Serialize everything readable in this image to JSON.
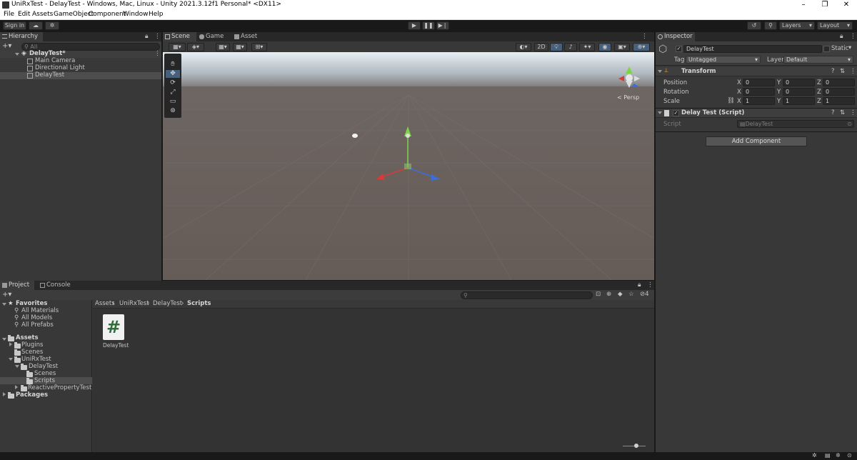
{
  "window": {
    "title": "UniRxTest - DelayTest - Windows, Mac, Linux - Unity 2021.3.12f1 Personal* <DX11>",
    "minimize": "–",
    "maximize": "❐",
    "close": "✕"
  },
  "menu": [
    "File",
    "Edit",
    "Assets",
    "GameObject",
    "Component",
    "Window",
    "Help"
  ],
  "toolbar": {
    "sign_in": "Sign in",
    "layers": "Layers",
    "layout": "Layout"
  },
  "hierarchy": {
    "tab": "Hierarchy",
    "search_placeholder": "All",
    "scene": "DelayTest*",
    "items": [
      "Main Camera",
      "Directional Light",
      "DelayTest"
    ]
  },
  "scene_view": {
    "tabs": [
      "Scene",
      "Game",
      "Asset Store"
    ],
    "mode_2d": "2D",
    "persp": "< Persp"
  },
  "inspector": {
    "tab": "Inspector",
    "object_name": "DelayTest",
    "static_label": "Static",
    "tag_label": "Tag",
    "tag_value": "Untagged",
    "layer_label": "Layer",
    "layer_value": "Default",
    "transform": {
      "title": "Transform",
      "rows": [
        {
          "label": "Position",
          "x": "0",
          "y": "0",
          "z": "0"
        },
        {
          "label": "Rotation",
          "x": "0",
          "y": "0",
          "z": "0"
        },
        {
          "label": "Scale",
          "x": "1",
          "y": "1",
          "z": "1"
        }
      ]
    },
    "script_component": {
      "title": "Delay Test (Script)",
      "script_label": "Script",
      "script_value": "DelayTest"
    },
    "add_component": "Add Component"
  },
  "project": {
    "tabs": [
      "Project",
      "Console"
    ],
    "favorites": "Favorites",
    "favorite_items": [
      "All Materials",
      "All Models",
      "All Prefabs"
    ],
    "assets": "Assets",
    "plugins": "Plugins",
    "scenes": "Scenes",
    "unirxtest": "UniRxTest",
    "delaytest": "DelayTest",
    "delaytest_scenes": "Scenes",
    "scripts": "Scripts",
    "reactive": "ReactivePropertyTest",
    "packages": "Packages",
    "breadcrumb": [
      "Assets",
      "UniRxTest",
      "DelayTest",
      "Scripts"
    ],
    "file_name": "DelayTest",
    "file_icon": "#",
    "hidden_count": "4"
  },
  "axis": {
    "x": "X",
    "y": "Y",
    "z": "Z"
  }
}
